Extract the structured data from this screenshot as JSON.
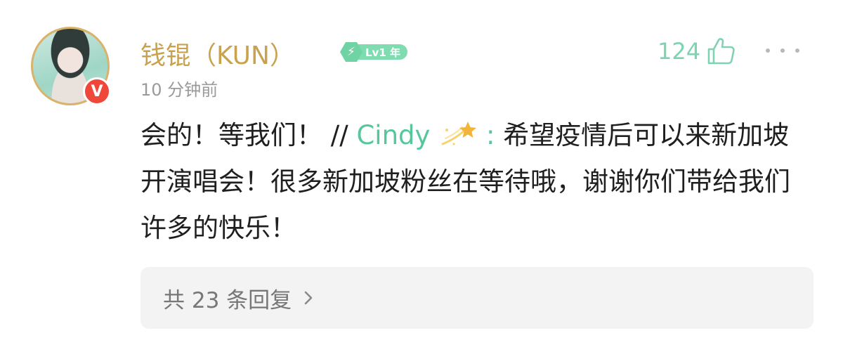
{
  "comment": {
    "username": "钱锟（KUN）",
    "level_badge": "Lv1 年",
    "level_icon": "lightning-bolt",
    "timestamp": "10 分钟前",
    "likes": "124",
    "verified_badge": "V",
    "body": {
      "reply_text": "会的！等我们！ ",
      "separator": "//",
      "mention": "Cindy",
      "mention_emoji": "dizzy-star-icon",
      "colon": ":",
      "quoted_text": "希望疫情后可以来新加坡开演唱会！很多新加坡粉丝在等待哦，谢谢你们带给我们许多的快乐！"
    },
    "replies_label": "共 23 条回复"
  },
  "colors": {
    "username": "#c9a24d",
    "accent_green": "#7fd3b1",
    "verified_red": "#f0473b",
    "timestamp_gray": "#9a9a9a"
  }
}
